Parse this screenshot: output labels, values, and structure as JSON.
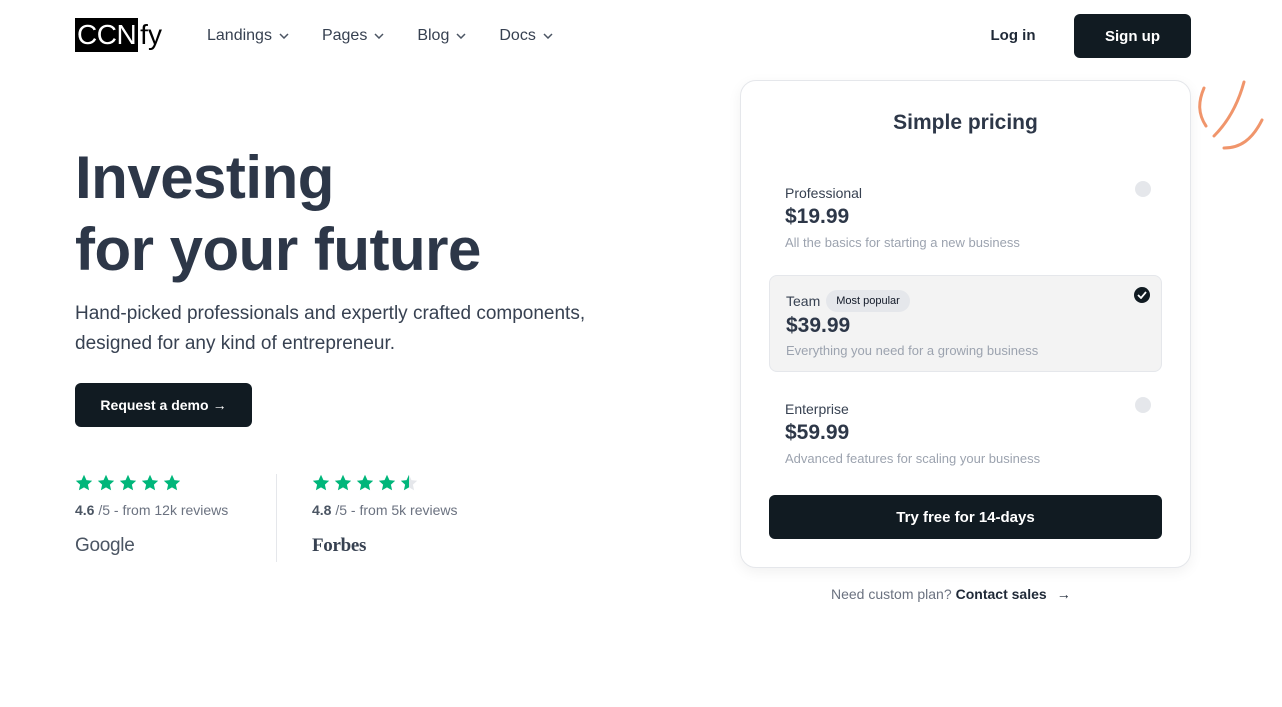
{
  "header": {
    "logo_box": "CCN",
    "logo_rest": "fy",
    "nav": [
      {
        "label": "Landings"
      },
      {
        "label": "Pages"
      },
      {
        "label": "Blog"
      },
      {
        "label": "Docs"
      }
    ],
    "login_label": "Log in",
    "signup_label": "Sign up"
  },
  "hero": {
    "title_line1": "Investing",
    "title_line2": "for your future",
    "subtitle_line1": "Hand-picked professionals and expertly crafted components,",
    "subtitle_line2": "designed for any kind of entrepreneur.",
    "cta_label": "Request a demo",
    "cta_arrow": "→"
  },
  "ratings": [
    {
      "score": "4.6",
      "suffix": "/5 - from 12k reviews",
      "brand": "Google",
      "stars": 5
    },
    {
      "score": "4.8",
      "suffix": "/5 - from 5k reviews",
      "brand": "Forbes",
      "stars": 4.5
    }
  ],
  "pricing": {
    "title": "Simple pricing",
    "plans": [
      {
        "name": "Professional",
        "price": "$19.99",
        "desc": "All the basics for starting a new business",
        "selected": false
      },
      {
        "name": "Team",
        "badge": "Most popular",
        "price": "$39.99",
        "desc": "Everything you need for a growing business",
        "selected": true
      },
      {
        "name": "Enterprise",
        "price": "$59.99",
        "desc": "Advanced features for scaling your business",
        "selected": false
      }
    ],
    "cta_label": "Try free for 14-days",
    "custom_text": "Need custom plan?",
    "custom_link": "Contact sales",
    "custom_arrow": "→"
  },
  "colors": {
    "dark_button": "#111b22",
    "star_green": "#00b67a",
    "accent_orange": "#f0956b"
  }
}
